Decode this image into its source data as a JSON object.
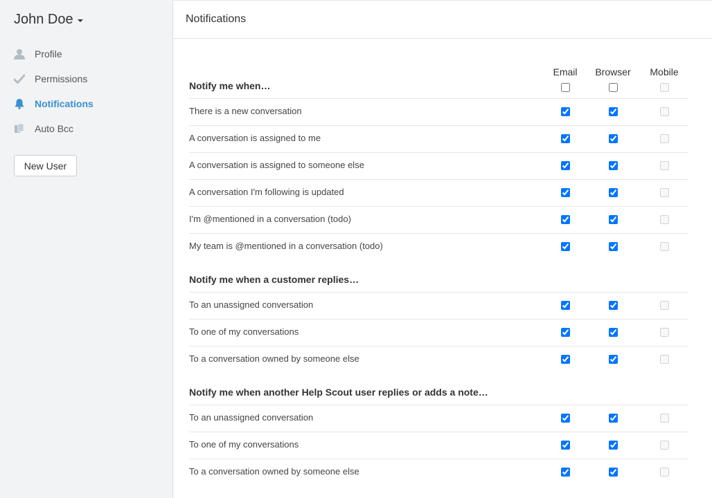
{
  "user": {
    "name": "John Doe"
  },
  "nav": [
    {
      "label": "Profile",
      "icon": "user-icon",
      "active": false
    },
    {
      "label": "Permissions",
      "icon": "check-icon",
      "active": false
    },
    {
      "label": "Notifications",
      "icon": "bell-icon",
      "active": true
    },
    {
      "label": "Auto Bcc",
      "icon": "copy-icon",
      "active": false
    }
  ],
  "new_user_label": "New User",
  "page_title": "Notifications",
  "columns": {
    "email": "Email",
    "browser": "Browser",
    "mobile": "Mobile"
  },
  "accent_color": "#3b8fcf",
  "sections": [
    {
      "title": "Notify me when…",
      "header_checkboxes": {
        "email": false,
        "browser": false,
        "mobile": false
      },
      "rows": [
        {
          "label": "There is a new conversation",
          "email": true,
          "browser": true,
          "mobile": false
        },
        {
          "label": "A conversation is assigned to me",
          "email": true,
          "browser": true,
          "mobile": false
        },
        {
          "label": "A conversation is assigned to someone else",
          "email": true,
          "browser": true,
          "mobile": false
        },
        {
          "label": "A conversation I'm following is updated",
          "email": true,
          "browser": true,
          "mobile": false
        },
        {
          "label": "I'm @mentioned in a conversation (todo)",
          "email": true,
          "browser": true,
          "mobile": false
        },
        {
          "label": "My team is @mentioned in a conversation (todo)",
          "email": true,
          "browser": true,
          "mobile": false
        }
      ]
    },
    {
      "title": "Notify me when a customer replies…",
      "rows": [
        {
          "label": "To an unassigned conversation",
          "email": true,
          "browser": true,
          "mobile": false
        },
        {
          "label": "To one of my conversations",
          "email": true,
          "browser": true,
          "mobile": false
        },
        {
          "label": "To a conversation owned by someone else",
          "email": true,
          "browser": true,
          "mobile": false
        }
      ]
    },
    {
      "title": "Notify me when another Help Scout user replies or adds a note…",
      "rows": [
        {
          "label": "To an unassigned conversation",
          "email": true,
          "browser": true,
          "mobile": false
        },
        {
          "label": "To one of my conversations",
          "email": true,
          "browser": true,
          "mobile": false
        },
        {
          "label": "To a conversation owned by someone else",
          "email": true,
          "browser": true,
          "mobile": false
        }
      ]
    }
  ]
}
